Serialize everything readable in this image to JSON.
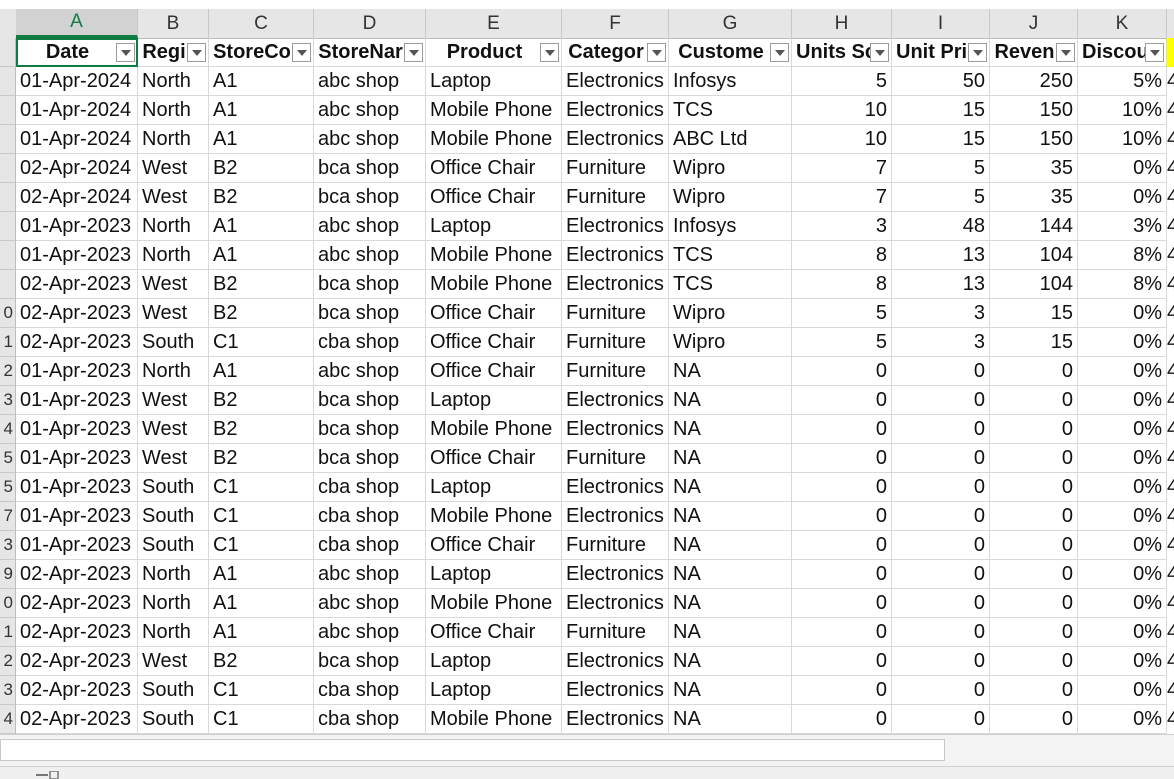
{
  "columns": [
    {
      "letter": "A",
      "header": "Date"
    },
    {
      "letter": "B",
      "header": "Regi"
    },
    {
      "letter": "C",
      "header": "StoreCo"
    },
    {
      "letter": "D",
      "header": "StoreNar"
    },
    {
      "letter": "E",
      "header": "Product"
    },
    {
      "letter": "F",
      "header": "Categor"
    },
    {
      "letter": "G",
      "header": "Custome"
    },
    {
      "letter": "H",
      "header": "Units Sc"
    },
    {
      "letter": "I",
      "header": "Unit Pri"
    },
    {
      "letter": "J",
      "header": "Reven"
    },
    {
      "letter": "K",
      "header": "Discou"
    }
  ],
  "row_numbers": [
    "",
    "",
    "",
    "",
    "",
    "",
    "",
    "",
    "0",
    "1",
    "2",
    "3",
    "4",
    "5",
    "5",
    "7",
    "3",
    "9",
    "0",
    "1",
    "2",
    "3",
    "4"
  ],
  "rows": [
    [
      "01-Apr-2024",
      "North",
      "A1",
      "abc shop",
      "Laptop",
      "Electronics",
      "Infosys",
      "5",
      "50",
      "250",
      "5%"
    ],
    [
      "01-Apr-2024",
      "North",
      "A1",
      "abc shop",
      "Mobile Phone",
      "Electronics",
      "TCS",
      "10",
      "15",
      "150",
      "10%"
    ],
    [
      "01-Apr-2024",
      "North",
      "A1",
      "abc shop",
      "Mobile Phone",
      "Electronics",
      "ABC Ltd",
      "10",
      "15",
      "150",
      "10%"
    ],
    [
      "02-Apr-2024",
      "West",
      "B2",
      "bca shop",
      "Office Chair",
      "Furniture",
      "Wipro",
      "7",
      "5",
      "35",
      "0%"
    ],
    [
      "02-Apr-2024",
      "West",
      "B2",
      "bca shop",
      "Office Chair",
      "Furniture",
      "Wipro",
      "7",
      "5",
      "35",
      "0%"
    ],
    [
      "01-Apr-2023",
      "North",
      "A1",
      "abc shop",
      "Laptop",
      "Electronics",
      "Infosys",
      "3",
      "48",
      "144",
      "3%"
    ],
    [
      "01-Apr-2023",
      "North",
      "A1",
      "abc shop",
      "Mobile Phone",
      "Electronics",
      "TCS",
      "8",
      "13",
      "104",
      "8%"
    ],
    [
      "02-Apr-2023",
      "West",
      "B2",
      "bca shop",
      "Mobile Phone",
      "Electronics",
      "TCS",
      "8",
      "13",
      "104",
      "8%"
    ],
    [
      "02-Apr-2023",
      "West",
      "B2",
      "bca shop",
      "Office Chair",
      "Furniture",
      "Wipro",
      "5",
      "3",
      "15",
      "0%"
    ],
    [
      "02-Apr-2023",
      "South",
      "C1",
      "cba shop",
      "Office Chair",
      "Furniture",
      "Wipro",
      "5",
      "3",
      "15",
      "0%"
    ],
    [
      "01-Apr-2023",
      "North",
      "A1",
      "abc shop",
      "Office Chair",
      "Furniture",
      "NA",
      "0",
      "0",
      "0",
      "0%"
    ],
    [
      "01-Apr-2023",
      "West",
      "B2",
      "bca shop",
      "Laptop",
      "Electronics",
      "NA",
      "0",
      "0",
      "0",
      "0%"
    ],
    [
      "01-Apr-2023",
      "West",
      "B2",
      "bca shop",
      "Mobile Phone",
      "Electronics",
      "NA",
      "0",
      "0",
      "0",
      "0%"
    ],
    [
      "01-Apr-2023",
      "West",
      "B2",
      "bca shop",
      "Office Chair",
      "Furniture",
      "NA",
      "0",
      "0",
      "0",
      "0%"
    ],
    [
      "01-Apr-2023",
      "South",
      "C1",
      "cba shop",
      "Laptop",
      "Electronics",
      "NA",
      "0",
      "0",
      "0",
      "0%"
    ],
    [
      "01-Apr-2023",
      "South",
      "C1",
      "cba shop",
      "Mobile Phone",
      "Electronics",
      "NA",
      "0",
      "0",
      "0",
      "0%"
    ],
    [
      "01-Apr-2023",
      "South",
      "C1",
      "cba shop",
      "Office Chair",
      "Furniture",
      "NA",
      "0",
      "0",
      "0",
      "0%"
    ],
    [
      "02-Apr-2023",
      "North",
      "A1",
      "abc shop",
      "Laptop",
      "Electronics",
      "NA",
      "0",
      "0",
      "0",
      "0%"
    ],
    [
      "02-Apr-2023",
      "North",
      "A1",
      "abc shop",
      "Mobile Phone",
      "Electronics",
      "NA",
      "0",
      "0",
      "0",
      "0%"
    ],
    [
      "02-Apr-2023",
      "North",
      "A1",
      "abc shop",
      "Office Chair",
      "Furniture",
      "NA",
      "0",
      "0",
      "0",
      "0%"
    ],
    [
      "02-Apr-2023",
      "West",
      "B2",
      "bca shop",
      "Laptop",
      "Electronics",
      "NA",
      "0",
      "0",
      "0",
      "0%"
    ],
    [
      "02-Apr-2023",
      "South",
      "C1",
      "cba shop",
      "Laptop",
      "Electronics",
      "NA",
      "0",
      "0",
      "0",
      "0%"
    ],
    [
      "02-Apr-2023",
      "South",
      "C1",
      "cba shop",
      "Mobile Phone",
      "Electronics",
      "NA",
      "0",
      "0",
      "0",
      "0%"
    ]
  ],
  "overflow_col_text": "4",
  "selected_column": "A",
  "active_cell": "A1",
  "colors": {
    "accent": "#107c41",
    "highlight": "#ffff00",
    "header_bg": "#e6e6e6"
  },
  "icons": {
    "filter": "filter-dropdown-icon"
  }
}
